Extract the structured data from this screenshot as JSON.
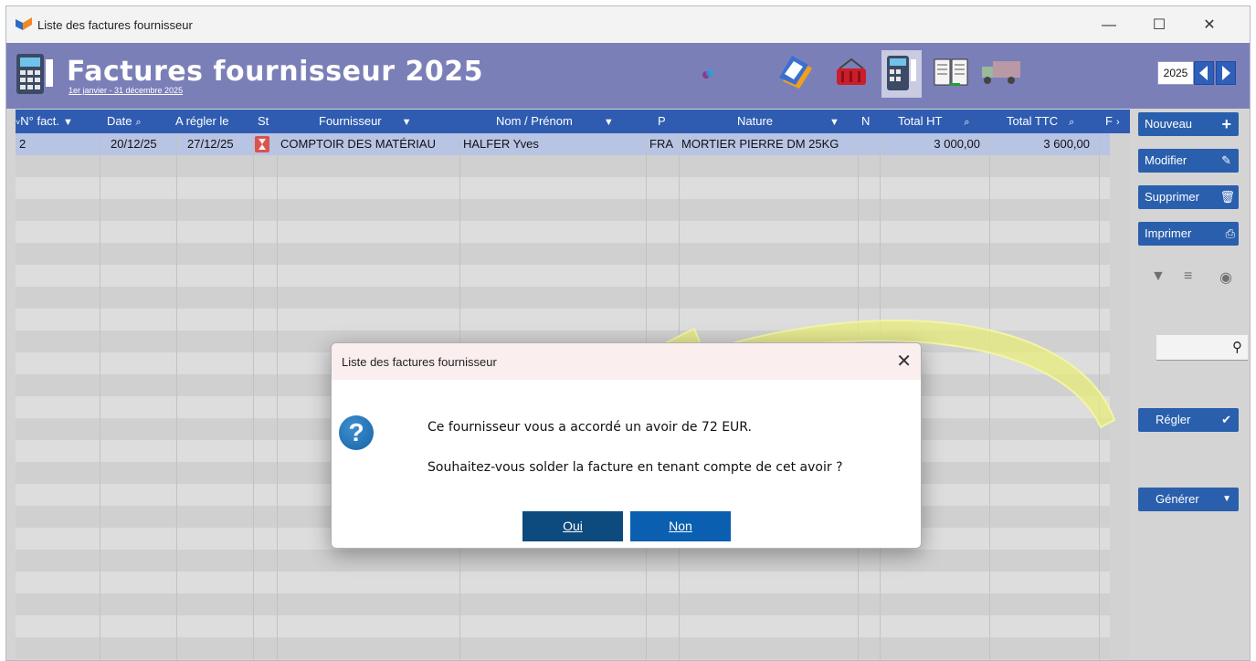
{
  "window": {
    "title": "Liste des factures fournisseur",
    "controls": [
      "—",
      "☐",
      "✕"
    ]
  },
  "header": {
    "title": "Factures fournisseur 2025",
    "subtitle": "1er janvier - 31 décembre 2025",
    "year": "2025"
  },
  "table": {
    "columns": [
      "N° fact.",
      "Date",
      "A régler le",
      "St",
      "Fournisseur",
      "Nom / Prénom",
      "P",
      "Nature",
      "N",
      "Total HT",
      "Total TTC",
      "F"
    ],
    "rows": [
      {
        "num": "2",
        "date": "20/12/25",
        "due": "27/12/25",
        "supplier": "COMPTOIR DES MATÉRIAU",
        "name": "HALFER Yves",
        "p": "FRA",
        "nature": "MORTIER PIERRE DM 25KG",
        "total_ht": "3 000,00",
        "total_ttc": "3 600,00"
      }
    ]
  },
  "side": {
    "nouveau": "Nouveau",
    "modifier": "Modifier",
    "supprimer": "Supprimer",
    "imprimer": "Imprimer",
    "regler": "Régler",
    "generer": "Générer"
  },
  "dialog": {
    "title": "Liste des factures fournisseur",
    "line1": "Ce fournisseur vous a accordé un avoir de 72 EUR.",
    "line2": "Souhaitez-vous solder la facture en tenant compte de cet avoir ?",
    "yes": "Oui",
    "no": "Non"
  },
  "colors": {
    "header_band": "#7b7fb8",
    "table_head": "#2f5cb0",
    "button": "#2a5fad",
    "arrow": "#e8ec7a"
  }
}
